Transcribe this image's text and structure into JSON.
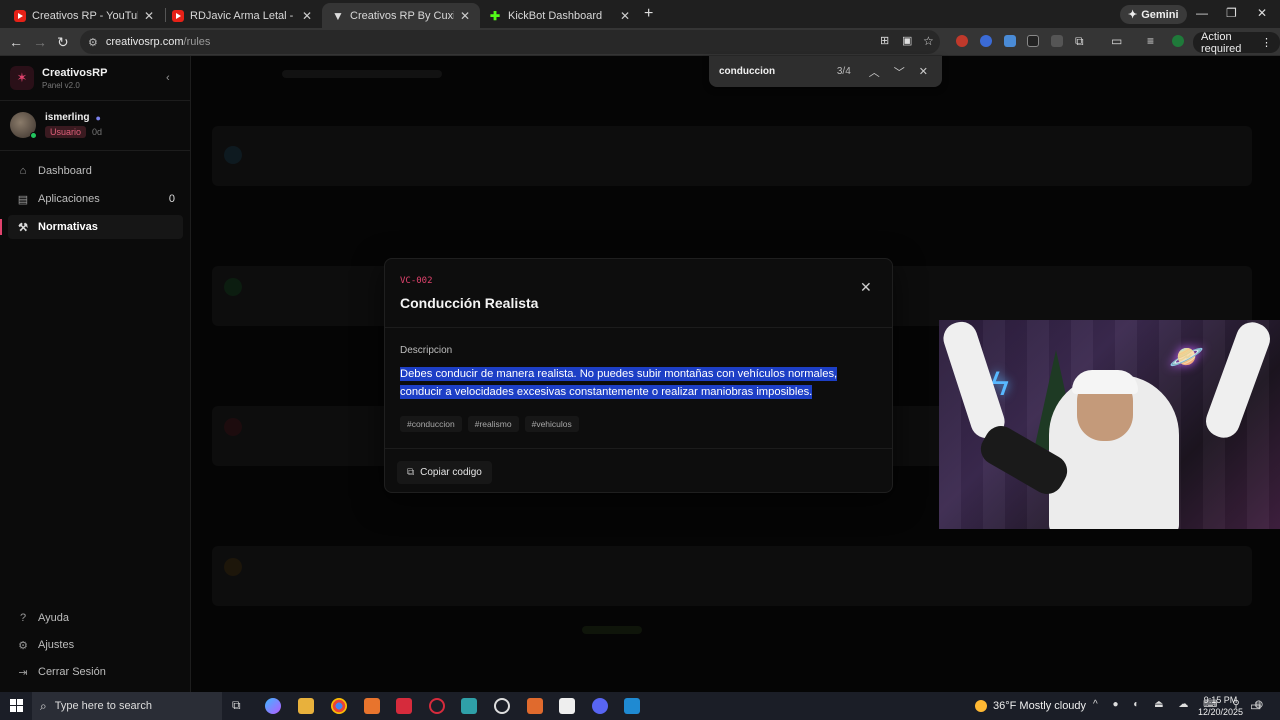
{
  "browser": {
    "tabs": [
      {
        "label": "Creativos RP - YouTube",
        "icon": "youtube-icon"
      },
      {
        "label": "RDJavic Arma Letal - Los Civiles",
        "icon": "youtube-icon"
      },
      {
        "label": "Creativos RP By Cuxial",
        "icon": "site-icon",
        "active": true
      },
      {
        "label": "KickBot Dashboard",
        "icon": "kick-icon"
      }
    ],
    "new_tab": "+",
    "gemini_label": "Gemini",
    "url_host": "creativosrp.com",
    "url_path": "/rules",
    "action_required": "Action required"
  },
  "find": {
    "query": "conduccion",
    "count": "3/4"
  },
  "sidebar": {
    "brand_name": "CreativosRP",
    "brand_version": "Panel v2.0",
    "user": {
      "name": "ismerling",
      "role": "Usuario",
      "days": "0d"
    },
    "nav": [
      {
        "label": "Dashboard",
        "icon": "home-icon"
      },
      {
        "label": "Aplicaciones",
        "icon": "document-icon",
        "badge": "0"
      },
      {
        "label": "Normativas",
        "icon": "gavel-icon",
        "active": true
      }
    ],
    "footer": [
      {
        "label": "Ayuda",
        "icon": "help-icon"
      },
      {
        "label": "Ajustes",
        "icon": "gear-icon"
      },
      {
        "label": "Cerrar Sesión",
        "icon": "logout-icon"
      }
    ]
  },
  "modal": {
    "code": "VC-002",
    "title": "Conducción Realista",
    "description_label": "Descripcion",
    "description": "Debes conducir de manera realista. No puedes subir montañas con vehículos normales, conducir a velocidades excesivas constantemente o realizar maniobras imposibles.",
    "tags": [
      "#conduccion",
      "#realismo",
      "#vehiculos"
    ],
    "copy_button": "Copiar codigo"
  },
  "taskbar": {
    "search_placeholder": "Type here to search",
    "weather": "36°F  Mostly cloudy",
    "time": "9:15 PM",
    "date": "12/20/2025"
  },
  "colors": {
    "accent": "#e0436d",
    "selection": "#1d3fc6",
    "background": "#050505"
  }
}
